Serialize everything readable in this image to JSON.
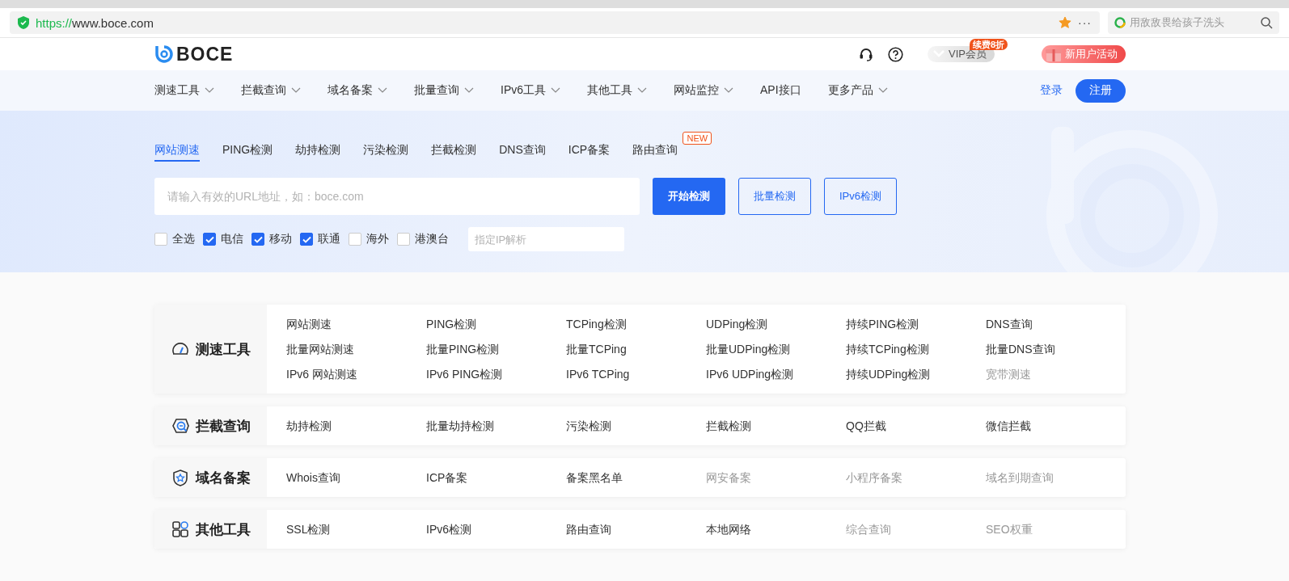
{
  "browser": {
    "url_scheme": "https://",
    "url_host": "www.boce.com",
    "bookmarked": true,
    "more": "···",
    "search_placeholder": "用敌敌畏给孩子洗头"
  },
  "header": {
    "logo": "BOCE",
    "vip": {
      "label": "VIP会员",
      "badge": "续费8折"
    },
    "promo": "新用户活动"
  },
  "nav": {
    "items": [
      {
        "label": "测速工具",
        "dropdown": true
      },
      {
        "label": "拦截查询",
        "dropdown": true
      },
      {
        "label": "域名备案",
        "dropdown": true
      },
      {
        "label": "批量查询",
        "dropdown": true
      },
      {
        "label": "IPv6工具",
        "dropdown": true
      },
      {
        "label": "其他工具",
        "dropdown": true
      },
      {
        "label": "网站监控",
        "dropdown": true
      },
      {
        "label": "API接口",
        "dropdown": false
      },
      {
        "label": "更多产品",
        "dropdown": true
      }
    ],
    "login": "登录",
    "register": "注册"
  },
  "hero": {
    "tabs": [
      {
        "label": "网站测速",
        "selected": true
      },
      {
        "label": "PING检测",
        "selected": false
      },
      {
        "label": "劫持检测",
        "selected": false
      },
      {
        "label": "污染检测",
        "selected": false
      },
      {
        "label": "拦截检测",
        "selected": false
      },
      {
        "label": "DNS查询",
        "selected": false
      },
      {
        "label": "ICP备案",
        "selected": false
      },
      {
        "label": "路由查询",
        "selected": false,
        "badge": "NEW"
      }
    ],
    "url_input": {
      "placeholder": "请输入有效的URL地址，如：boce.com"
    },
    "buttons": [
      {
        "label": "开始检测",
        "kind": "primary"
      },
      {
        "label": "批量检测",
        "kind": "outline"
      },
      {
        "label": "IPv6检测",
        "kind": "outline"
      }
    ],
    "carriers": [
      {
        "label": "全选",
        "checked": false
      },
      {
        "label": "电信",
        "checked": true
      },
      {
        "label": "移动",
        "checked": true
      },
      {
        "label": "联通",
        "checked": true
      },
      {
        "label": "海外",
        "checked": false
      },
      {
        "label": "港澳台",
        "checked": false
      }
    ],
    "ip_input": {
      "placeholder": "指定IP解析"
    }
  },
  "categories": [
    {
      "title": "测速工具",
      "kind": "gauge",
      "items": [
        {
          "label": "网站测速",
          "disabled": false
        },
        {
          "label": "PING检测",
          "disabled": false
        },
        {
          "label": "TCPing检测",
          "disabled": false
        },
        {
          "label": "UDPing检测",
          "disabled": false
        },
        {
          "label": "持续PING检测",
          "disabled": false
        },
        {
          "label": "DNS查询",
          "disabled": false
        },
        {
          "label": "批量网站测速",
          "disabled": false
        },
        {
          "label": "批量PING检测",
          "disabled": false
        },
        {
          "label": "批量TCPing",
          "disabled": false
        },
        {
          "label": "批量UDPing检测",
          "disabled": false
        },
        {
          "label": "持续TCPing检测",
          "disabled": false
        },
        {
          "label": "批量DNS查询",
          "disabled": false
        },
        {
          "label": "IPv6 网站测速",
          "disabled": false
        },
        {
          "label": "IPv6 PING检测",
          "disabled": false
        },
        {
          "label": "IPv6 TCPing",
          "disabled": false
        },
        {
          "label": "IPv6 UDPing检测",
          "disabled": false
        },
        {
          "label": "持续UDPing检测",
          "disabled": false
        },
        {
          "label": "宽带测速",
          "disabled": true
        }
      ]
    },
    {
      "title": "拦截查询",
      "kind": "search",
      "items": [
        {
          "label": "劫持检测",
          "disabled": false
        },
        {
          "label": "批量劫持检测",
          "disabled": false
        },
        {
          "label": "污染检测",
          "disabled": false
        },
        {
          "label": "拦截检测",
          "disabled": false
        },
        {
          "label": "QQ拦截",
          "disabled": false
        },
        {
          "label": "微信拦截",
          "disabled": false
        }
      ]
    },
    {
      "title": "域名备案",
      "kind": "shield",
      "items": [
        {
          "label": "Whois查询",
          "disabled": false
        },
        {
          "label": "ICP备案",
          "disabled": false
        },
        {
          "label": "备案黑名单",
          "disabled": false
        },
        {
          "label": "网安备案",
          "disabled": true
        },
        {
          "label": "小程序备案",
          "disabled": true
        },
        {
          "label": "域名到期查询",
          "disabled": true
        }
      ]
    },
    {
      "title": "其他工具",
      "kind": "apps",
      "items": [
        {
          "label": "SSL检测",
          "disabled": false
        },
        {
          "label": "IPv6检测",
          "disabled": false
        },
        {
          "label": "路由查询",
          "disabled": false
        },
        {
          "label": "本地网络",
          "disabled": false
        },
        {
          "label": "综合查询",
          "disabled": true
        },
        {
          "label": "SEO权重",
          "disabled": true
        }
      ]
    }
  ]
}
